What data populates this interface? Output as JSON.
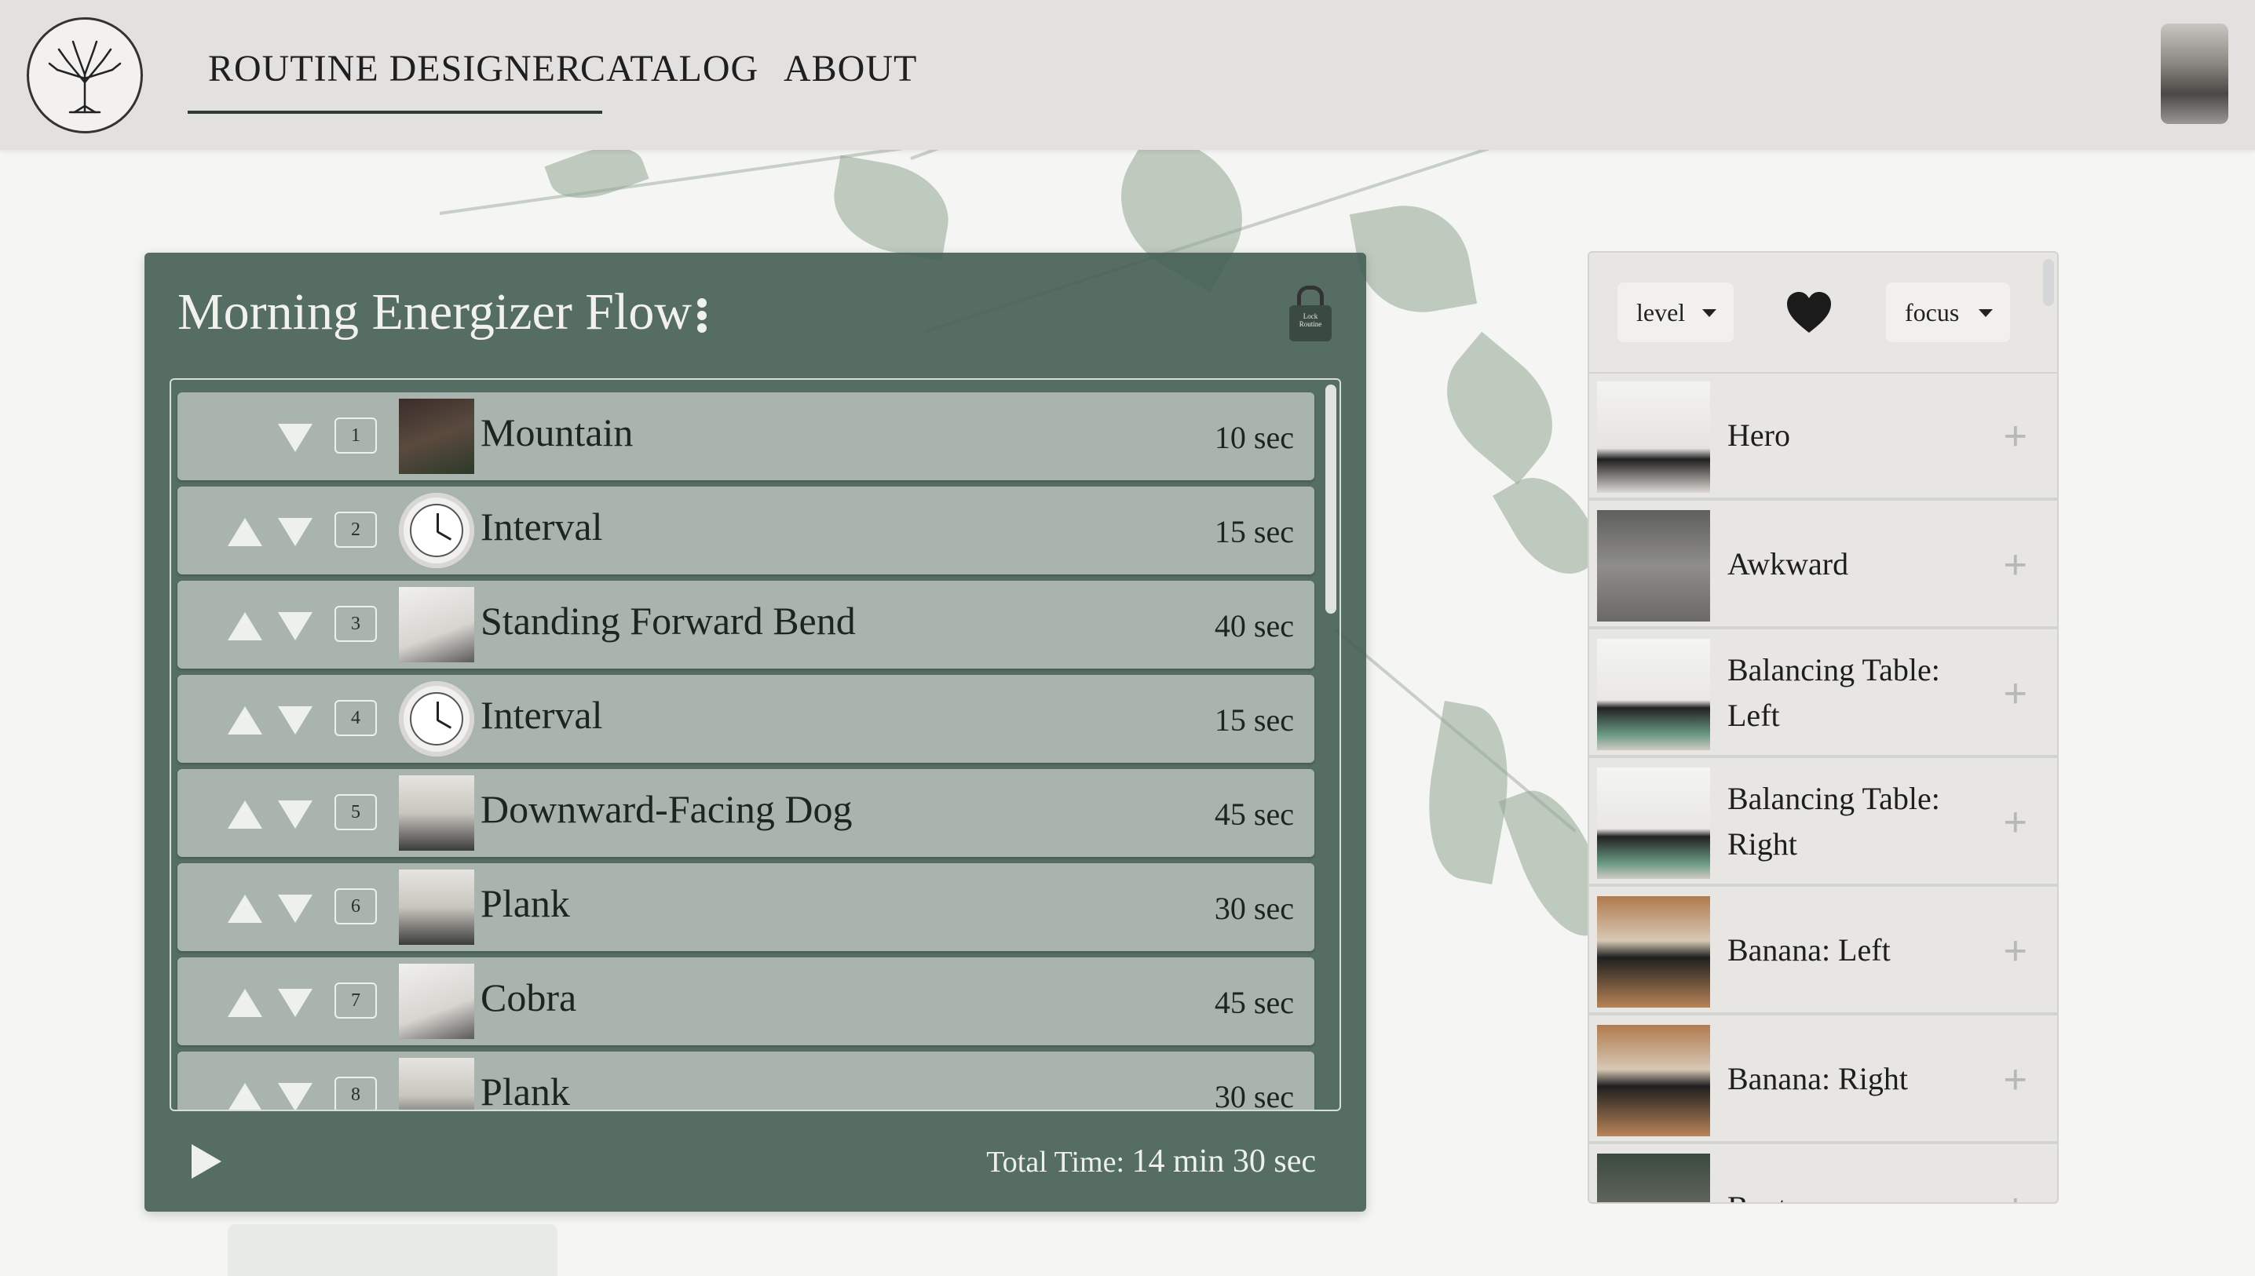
{
  "nav": {
    "items": [
      "ROUTINE DESIGNER",
      "CATALOG",
      "ABOUT"
    ],
    "active": "ROUTINE DESIGNER"
  },
  "routine": {
    "title": "Morning Energizer Flow",
    "lock_label_1": "Lock",
    "lock_label_2": "Routine",
    "steps": [
      {
        "num": "1",
        "name": "Mountain",
        "duration": "10 sec",
        "type": "pose"
      },
      {
        "num": "2",
        "name": "Interval",
        "duration": "15 sec",
        "type": "interval"
      },
      {
        "num": "3",
        "name": "Standing Forward Bend",
        "duration": "40 sec",
        "type": "pose"
      },
      {
        "num": "4",
        "name": "Interval",
        "duration": "15 sec",
        "type": "interval"
      },
      {
        "num": "5",
        "name": "Downward-Facing Dog",
        "duration": "45 sec",
        "type": "pose"
      },
      {
        "num": "6",
        "name": "Plank",
        "duration": "30 sec",
        "type": "pose"
      },
      {
        "num": "7",
        "name": "Cobra",
        "duration": "45 sec",
        "type": "pose"
      },
      {
        "num": "8",
        "name": "Plank",
        "duration": "30 sec",
        "type": "pose"
      }
    ],
    "total_label": "Total Time:",
    "total_value": "14 min 30 sec"
  },
  "catalog": {
    "level_label": "level",
    "focus_label": "focus",
    "items": [
      {
        "name": "Hero"
      },
      {
        "name": "Awkward"
      },
      {
        "name": "Balancing Table: Left"
      },
      {
        "name": "Balancing Table: Right"
      },
      {
        "name": "Banana: Left"
      },
      {
        "name": "Banana: Right"
      },
      {
        "name": "Boat"
      }
    ],
    "add_symbol": "+"
  },
  "colors": {
    "nav_bg": "#e2e1df",
    "routine_bg": "#466156",
    "row_bg": "#a9b4ae",
    "catalog_bg": "#e7e6e3"
  }
}
